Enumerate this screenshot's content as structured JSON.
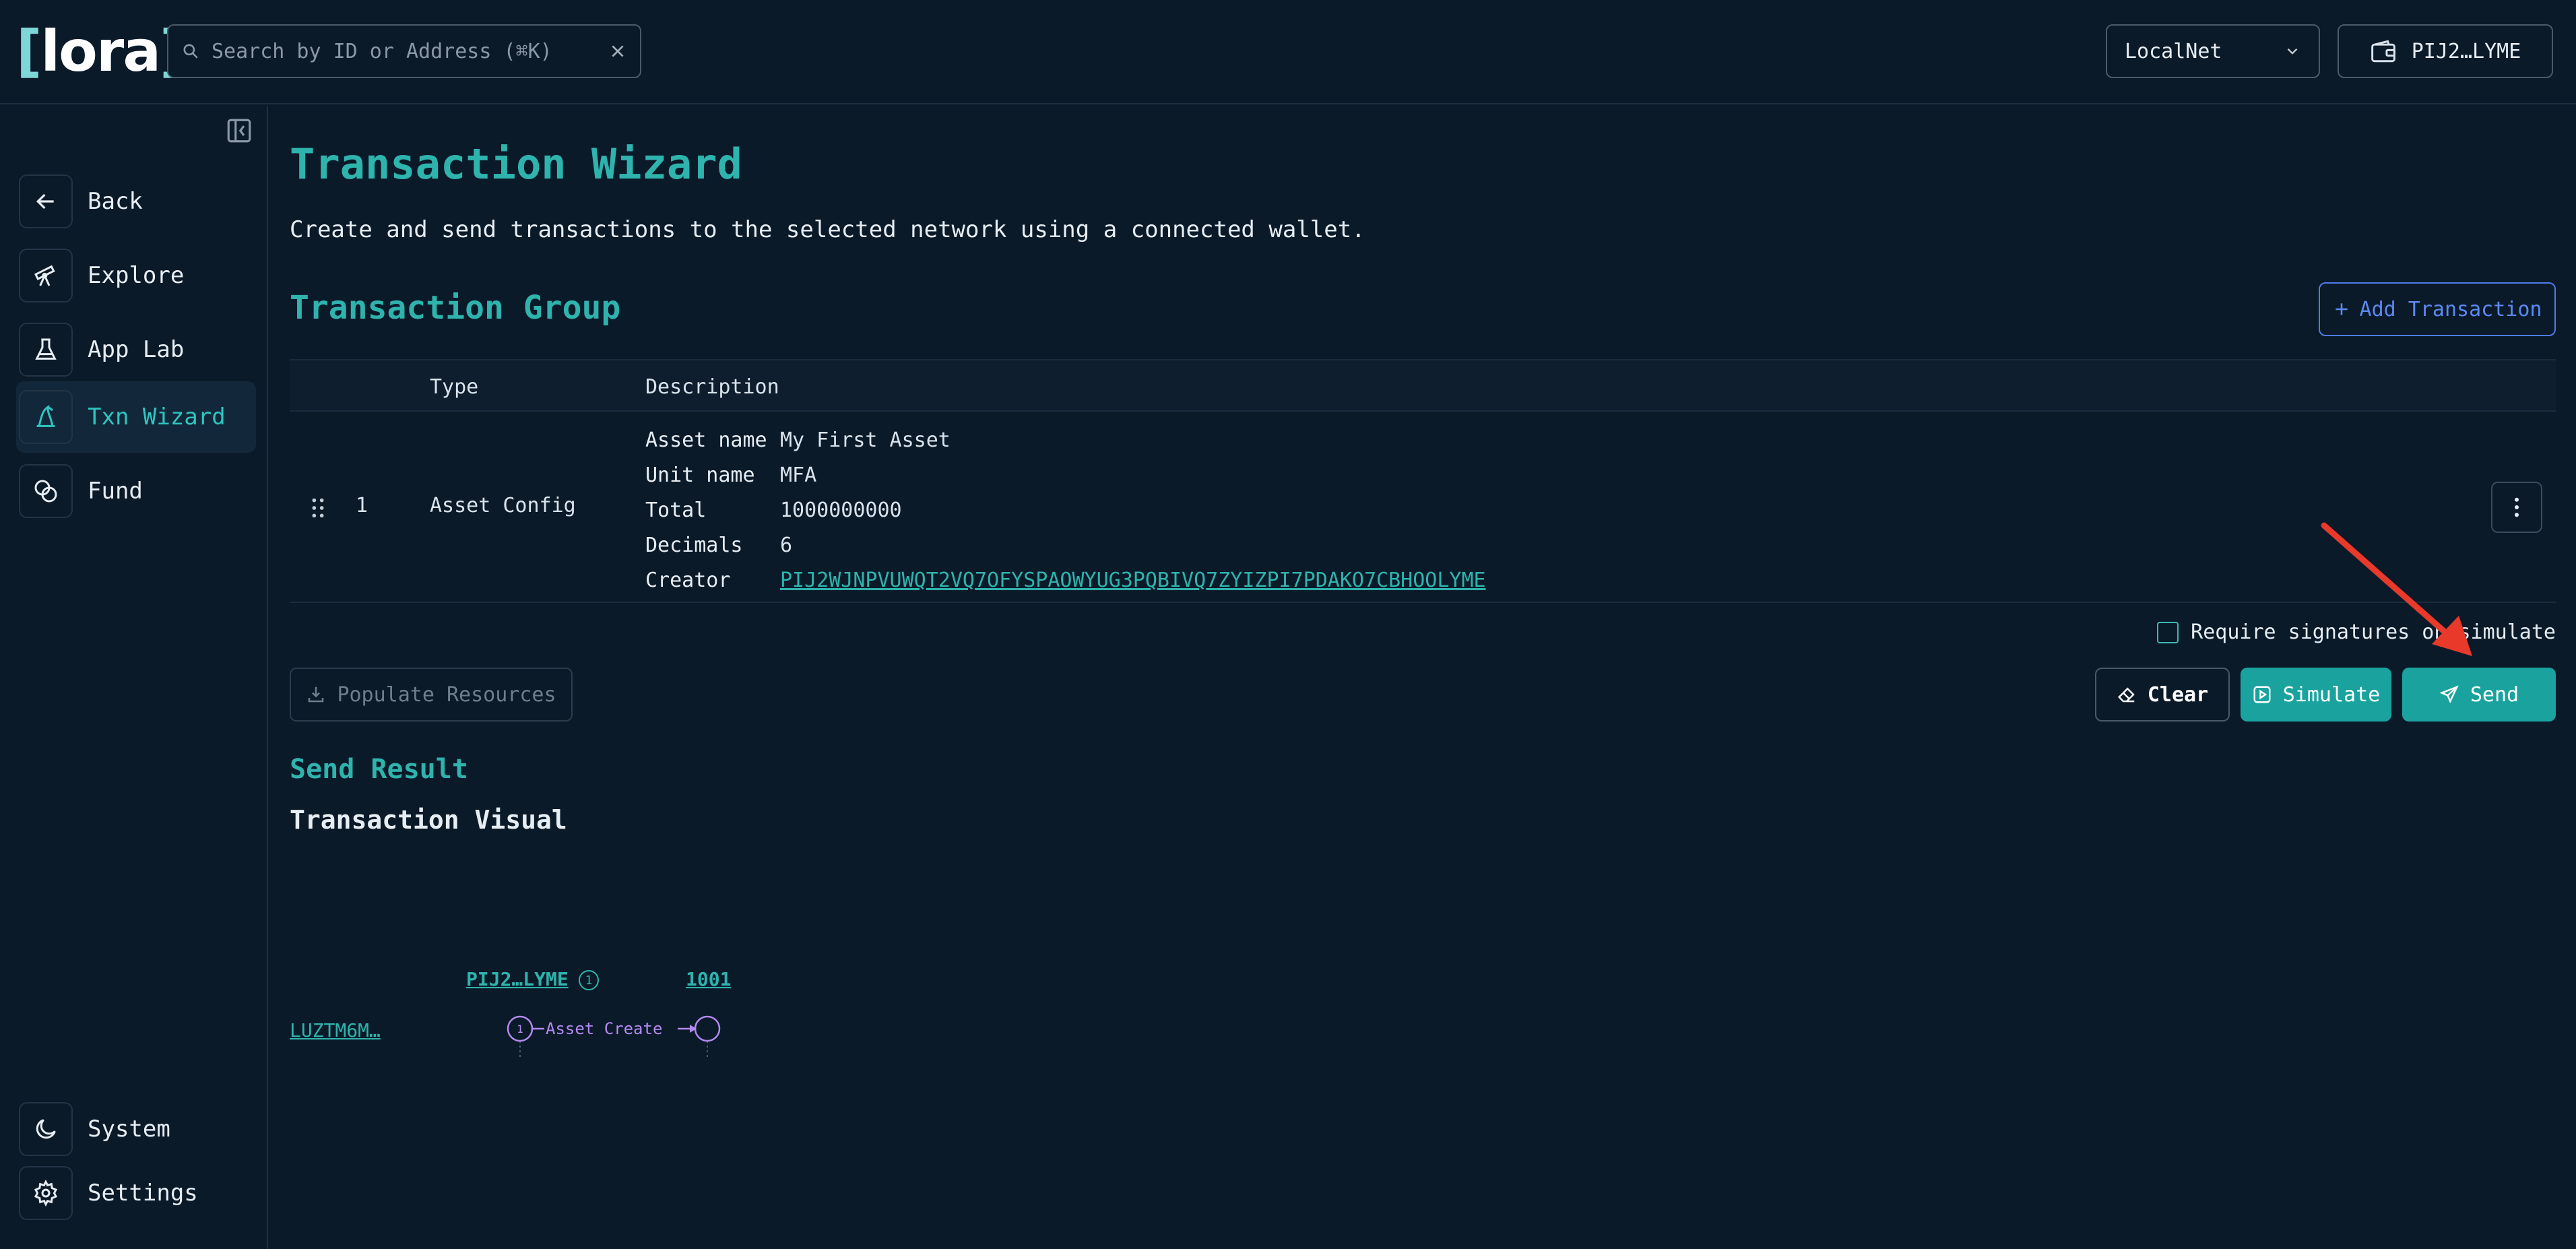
{
  "header": {
    "logo": {
      "open": "[",
      "text": "lora",
      "close": "]"
    },
    "search": {
      "placeholder": "Search by ID or Address (⌘K)",
      "value": ""
    },
    "network": {
      "label": "LocalNet"
    },
    "wallet": {
      "label": "PIJ2…LYME"
    }
  },
  "sidebar": {
    "items": [
      {
        "label": "Back",
        "icon": "arrow-left-icon"
      },
      {
        "label": "Explore",
        "icon": "telescope-icon"
      },
      {
        "label": "App Lab",
        "icon": "flask-icon"
      },
      {
        "label": "Txn Wizard",
        "icon": "wizard-hat-icon",
        "active": true
      },
      {
        "label": "Fund",
        "icon": "coins-icon"
      }
    ],
    "bottom": [
      {
        "label": "System",
        "icon": "moon-icon"
      },
      {
        "label": "Settings",
        "icon": "gear-icon"
      }
    ]
  },
  "main": {
    "title": "Transaction Wizard",
    "subtitle": "Create and send transactions to the selected network using a connected wallet.",
    "group_title": "Transaction Group",
    "add_transaction": "Add Transaction",
    "table": {
      "headers": [
        "Type",
        "Description"
      ],
      "rows": [
        {
          "index": "1",
          "type": "Asset Config",
          "details": [
            {
              "key": "Asset name",
              "value": "My First Asset"
            },
            {
              "key": "Unit name",
              "value": "MFA"
            },
            {
              "key": "Total",
              "value": "1000000000"
            },
            {
              "key": "Decimals",
              "value": "6"
            },
            {
              "key": "Creator",
              "value": "PIJ2WJNPVUWQT2VQ7OFYSPAOWYUG3PQBIVQ7ZYIZPI7PDAKO7CBHOOLYME"
            }
          ]
        }
      ]
    },
    "require_signatures": "Require signatures on simulate",
    "buttons": {
      "populate": "Populate Resources",
      "clear": "Clear",
      "simulate": "Simulate",
      "send": "Send"
    },
    "send_result_title": "Send Result",
    "visual_title": "Transaction Visual",
    "visual": {
      "account": "PIJ2…LYME",
      "account_badge": "1",
      "asset": "1001",
      "txn_id": "LUZTM6M…",
      "txn_index": "1",
      "action": "Asset Create"
    }
  },
  "colors": {
    "background": "#0b1a29",
    "accent": "#2fb3ad",
    "button": "#1aa39e",
    "link_blue": "#5b8af2",
    "annotation_arrow": "#e8392a",
    "visual_purple": "#b38af0"
  }
}
